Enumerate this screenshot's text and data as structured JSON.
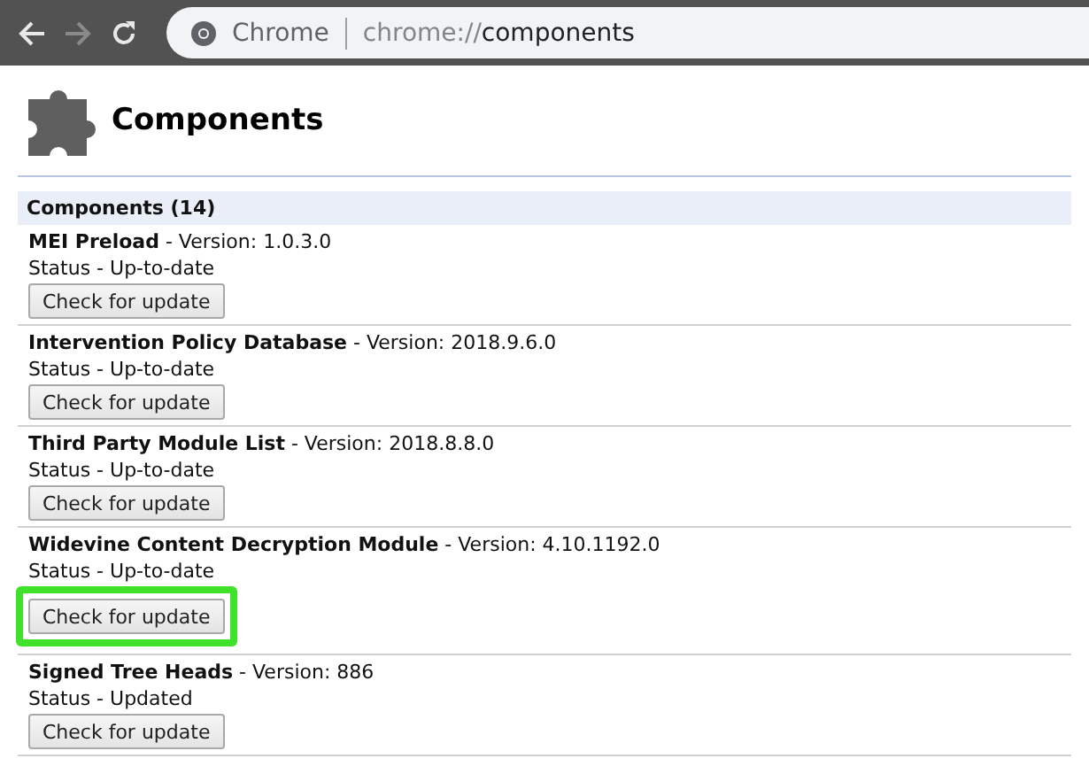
{
  "toolbar": {
    "site_label": "Chrome",
    "url_scheme": "chrome://",
    "url_path": "components",
    "forward_disabled": true
  },
  "page": {
    "title": "Components"
  },
  "section": {
    "title": "Components (14)"
  },
  "components": [
    {
      "name": "MEI Preload",
      "version": " - Version: 1.0.3.0",
      "status": "Status - Up-to-date",
      "button": "Check for update",
      "highlighted": false
    },
    {
      "name": "Intervention Policy Database",
      "version": " - Version: 2018.9.6.0",
      "status": "Status - Up-to-date",
      "button": "Check for update",
      "highlighted": false
    },
    {
      "name": "Third Party Module List",
      "version": " - Version: 2018.8.8.0",
      "status": "Status - Up-to-date",
      "button": "Check for update",
      "highlighted": false
    },
    {
      "name": "Widevine Content Decryption Module",
      "version": " - Version: 4.10.1192.0",
      "status": "Status - Up-to-date",
      "button": "Check for update",
      "highlighted": true
    },
    {
      "name": "Signed Tree Heads",
      "version": " - Version: 886",
      "status": "Status - Updated",
      "button": "Check for update",
      "highlighted": false
    }
  ]
}
